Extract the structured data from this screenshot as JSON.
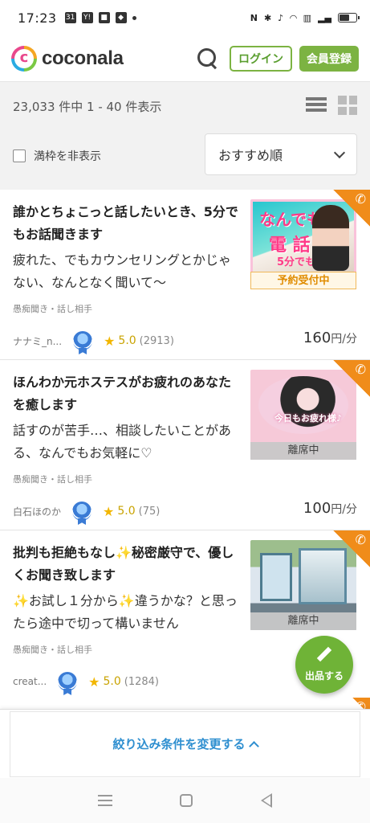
{
  "status_bar": {
    "time": "17:23",
    "icons_left": [
      "calendar-icon",
      "yahoo-icon",
      "note-icon",
      "app-icon",
      "dot-icon"
    ],
    "icons_right": [
      "nfc-icon",
      "bluetooth-icon",
      "mute-icon",
      "wifi-icon",
      "volte-icon",
      "signal-icon",
      "battery-icon"
    ]
  },
  "header": {
    "logo_text": "coconala",
    "login_label": "ログイン",
    "signup_label": "会員登録"
  },
  "filter": {
    "result_count": "23,033 件中 1 - 40 件表示",
    "hide_full_label": "満枠を非表示",
    "sort_selected": "おすすめ順"
  },
  "listings": [
    {
      "title": "誰かとちょこっと話したいとき、5分でもお話聞きます",
      "description": "疲れた、でもカウンセリングとかじゃない、なんとなく聞いて〜",
      "category": "愚痴聞き・話し相手",
      "user": "ナナミ_n...",
      "rating": "5.0",
      "review_count": "(2913)",
      "price": "160",
      "price_unit": "円/分",
      "status": "予約受付中",
      "thumb_text_1": "なんでも",
      "thumb_text_2": "電 話",
      "thumb_text_3": "5分でもok"
    },
    {
      "title": "ほんわか元ホステスがお疲れのあなたを癒します",
      "description": "話すのが苦手…、相談したいことがある、なんでもお気軽に♡",
      "category": "愚痴聞き・話し相手",
      "user": "白石ほのか",
      "rating": "5.0",
      "review_count": "(75)",
      "price": "100",
      "price_unit": "円/分",
      "status": "離席中",
      "thumb_text_1": "今日もお疲れ様♪"
    },
    {
      "title": "批判も拒絶もなし✨秘密厳守で、優しくお聞き致します",
      "description": "✨お試し１分から✨違うかな？と思ったら途中で切って構いません",
      "category": "愚痴聞き・話し相手",
      "user": "creat...",
      "rating": "5.0",
      "review_count": "(1284)",
      "price": "",
      "price_unit": "",
      "status": "離席中"
    }
  ],
  "fab": {
    "label": "出品する"
  },
  "bottom_bar": {
    "filter_change_label": "絞り込み条件を変更する"
  },
  "colors": {
    "brand_green": "#7cb342",
    "link_blue": "#2f8fd0",
    "call_orange": "#f08c1a",
    "star_gold": "#f2b600"
  }
}
